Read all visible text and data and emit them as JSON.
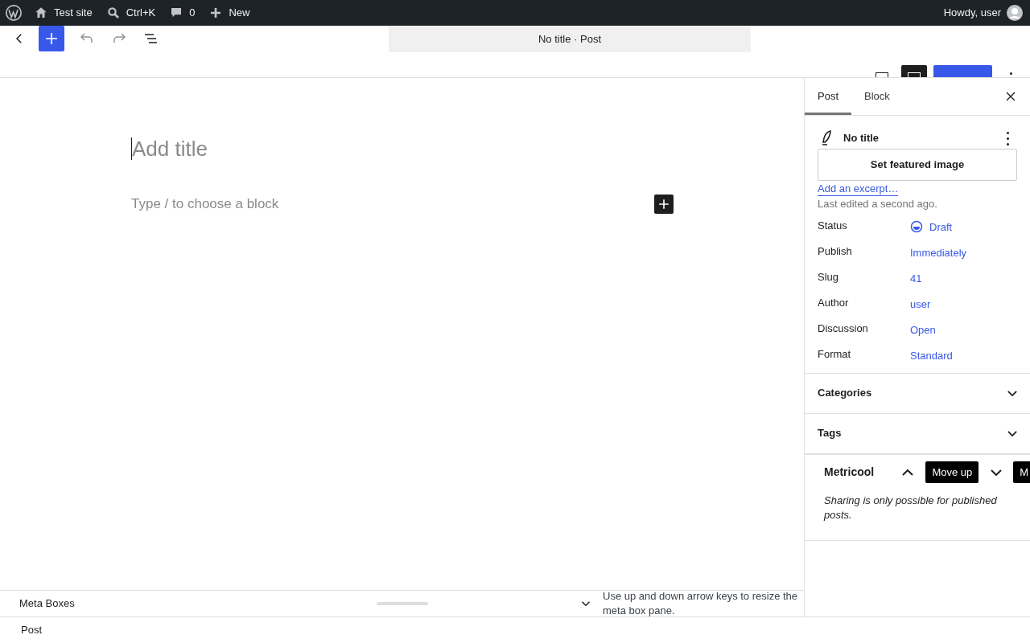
{
  "admin_bar": {
    "site": "Test site",
    "search_shortcut": "Ctrl+K",
    "comments": "0",
    "new": "New",
    "greeting": "Howdy, user"
  },
  "header": {
    "document_title": "No title · Post",
    "tools": [
      {
        "kind": "undo",
        "disabled": true
      },
      {
        "kind": "redo",
        "disabled": true
      }
    ],
    "settings_selected": true
  },
  "editor": {
    "title_placeholder": "Add title",
    "block_placeholder": "Type / to choose a block"
  },
  "sidebar": {
    "tabs": [
      {
        "label": "Post",
        "selected": true
      },
      {
        "label": "Block",
        "selected": false
      }
    ],
    "post_title": "No title",
    "featured_image_button": "Set featured image",
    "excerpt_link": "Add an excerpt…",
    "last_edited": "Last edited a second ago.",
    "fields": [
      {
        "label": "Status",
        "value": "Draft",
        "kind": "status"
      },
      {
        "label": "Publish",
        "value": "Immediately",
        "kind": "link"
      },
      {
        "label": "Slug",
        "value": "41",
        "kind": "link"
      },
      {
        "label": "Author",
        "value": "user",
        "kind": "link"
      },
      {
        "label": "Discussion",
        "value": "Open",
        "kind": "link"
      },
      {
        "label": "Format",
        "value": "Standard",
        "kind": "link"
      }
    ],
    "panels": [
      {
        "title": "Categories",
        "expanded": false
      },
      {
        "title": "Tags",
        "expanded": false
      }
    ],
    "metabox": {
      "title": "Metricool",
      "tooltips": [
        "Move up",
        "M"
      ],
      "message": "Sharing is only possible for published posts."
    }
  },
  "meta_boxes": {
    "label": "Meta Boxes",
    "hint": "Use up and down arrow keys to resize the meta box pane."
  },
  "footer": {
    "breadcrumb": "Post"
  }
}
